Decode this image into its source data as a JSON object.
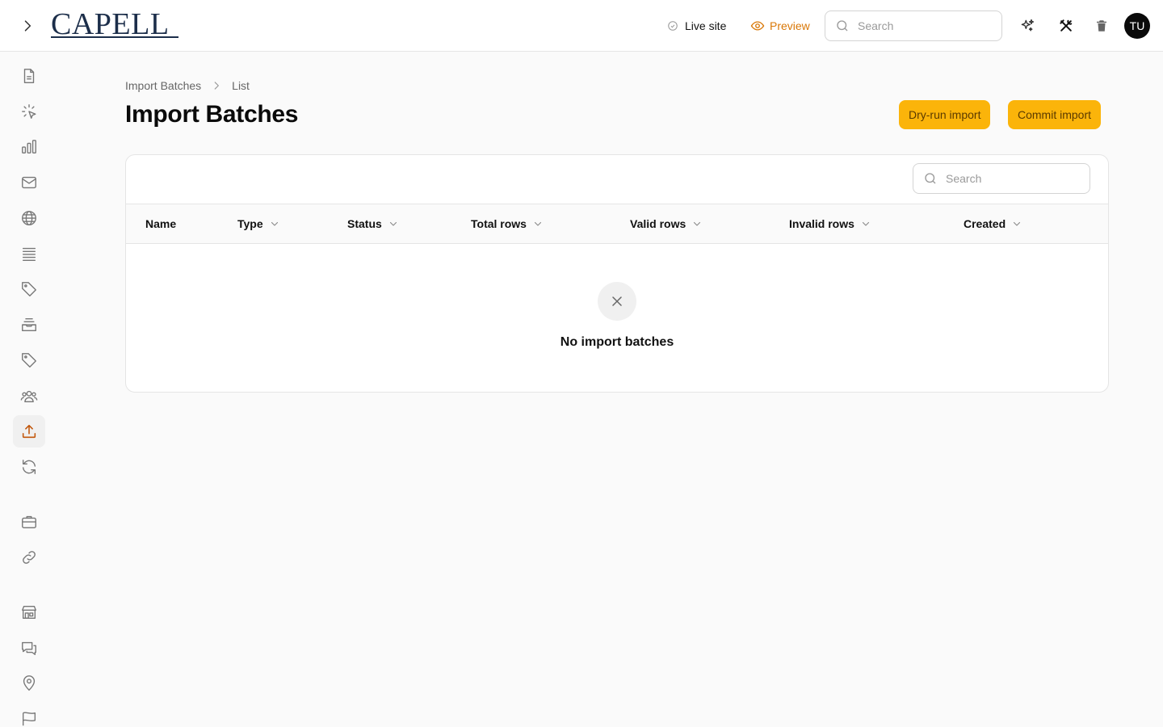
{
  "topbar": {
    "logo_text": "CAPELL",
    "live_site_label": "Live site",
    "preview_label": "Preview",
    "search_placeholder": "Search",
    "avatar_initials": "TU",
    "accent_color": "#d97706"
  },
  "sidebar": {
    "items": [
      {
        "icon": "document-icon",
        "active": false
      },
      {
        "icon": "cursor-click-icon",
        "active": false
      },
      {
        "icon": "bar-chart-icon",
        "active": false
      },
      {
        "icon": "mail-icon",
        "active": false
      },
      {
        "icon": "globe-icon",
        "active": false
      },
      {
        "icon": "list-icon",
        "active": false
      },
      {
        "icon": "tag-icon",
        "active": false
      },
      {
        "icon": "inbox-stack-icon",
        "active": false
      },
      {
        "icon": "tag-icon",
        "active": false
      },
      {
        "icon": "users-group-icon",
        "active": false
      },
      {
        "icon": "upload-icon",
        "active": true
      },
      {
        "icon": "refresh-icon",
        "active": false
      },
      {
        "icon": "briefcase-icon",
        "active": false
      },
      {
        "icon": "link-icon",
        "active": false
      },
      {
        "icon": "building-storefront-icon",
        "active": false
      },
      {
        "icon": "chat-bubbles-icon",
        "active": false
      },
      {
        "icon": "map-pin-icon",
        "active": false
      },
      {
        "icon": "flag-icon",
        "active": false
      }
    ]
  },
  "breadcrumb": {
    "parent": "Import Batches",
    "current": "List"
  },
  "page": {
    "title": "Import Batches",
    "dry_run_label": "Dry-run import",
    "commit_label": "Commit import"
  },
  "table": {
    "search_placeholder": "Search",
    "columns": [
      {
        "label": "Name",
        "sortable": false
      },
      {
        "label": "Type",
        "sortable": true
      },
      {
        "label": "Status",
        "sortable": true
      },
      {
        "label": "Total rows",
        "sortable": true
      },
      {
        "label": "Valid rows",
        "sortable": true
      },
      {
        "label": "Invalid rows",
        "sortable": true
      },
      {
        "label": "Created",
        "sortable": true
      }
    ],
    "rows": [],
    "empty_text": "No import batches"
  }
}
